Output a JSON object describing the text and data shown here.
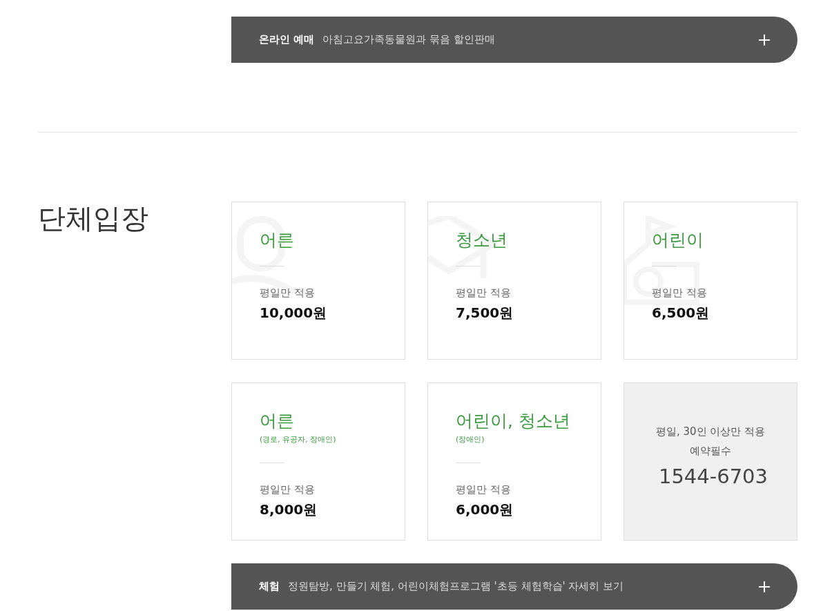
{
  "banners_top": [
    {
      "label": "온라인 예매",
      "text": "아침고요가족동물원과 묶음 할인판매"
    }
  ],
  "section": {
    "title": "단체입장"
  },
  "cards": [
    {
      "kind": "price",
      "title": "어른",
      "note": "평일만 적용",
      "price": "10,000원"
    },
    {
      "kind": "price",
      "title": "청소년",
      "note": "평일만 적용",
      "price": "7,500원"
    },
    {
      "kind": "price",
      "title": "어린이",
      "note": "평일만 적용",
      "price": "6,500원"
    },
    {
      "kind": "price",
      "title": "어른",
      "subtitle": "(경로, 유공자, 장애인)",
      "note": "평일만 적용",
      "price": "8,000원"
    },
    {
      "kind": "price",
      "title": "어린이, 청소년",
      "subtitle": "(장애인)",
      "note": "평일만 적용",
      "price": "6,000원"
    },
    {
      "kind": "info",
      "lines": [
        "평일, 30인 이상만 적용",
        "예약필수"
      ],
      "phone": "1544-6703"
    }
  ],
  "banners_bottom": [
    {
      "label": "체험",
      "text": "정원탐방, 만들기 체험, 어린이체험프로그램 '초등 체험학습' 자세히 보기"
    }
  ]
}
